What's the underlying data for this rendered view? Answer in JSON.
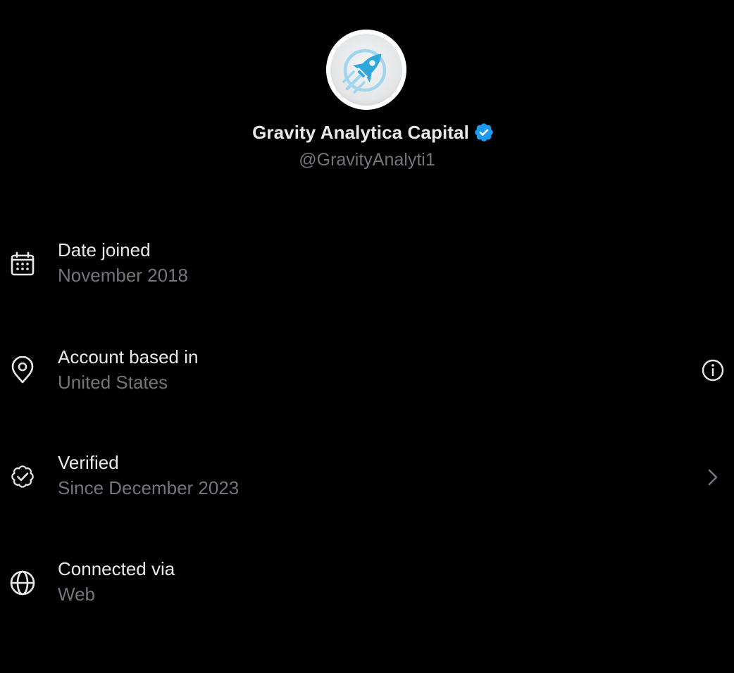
{
  "profile": {
    "display_name": "Gravity Analytica Capital",
    "handle": "@GravityAnalyti1",
    "avatar_icon": "rocket-logo-icon",
    "verified_color": "#1d9bf0"
  },
  "info": {
    "date_joined": {
      "title": "Date joined",
      "value": "November 2018",
      "icon": "calendar-icon"
    },
    "account_based": {
      "title": "Account based in",
      "value": "United States",
      "icon": "location-pin-icon",
      "action_icon": "info-icon"
    },
    "verified": {
      "title": "Verified",
      "value": "Since December 2023",
      "icon": "verified-check-icon",
      "action_icon": "chevron-right-icon"
    },
    "connected_via": {
      "title": "Connected via",
      "value": "Web",
      "icon": "globe-icon"
    }
  },
  "colors": {
    "background": "#000000",
    "primary_text": "#e7e9ea",
    "secondary_text": "#71767b",
    "accent": "#1d9bf0"
  }
}
